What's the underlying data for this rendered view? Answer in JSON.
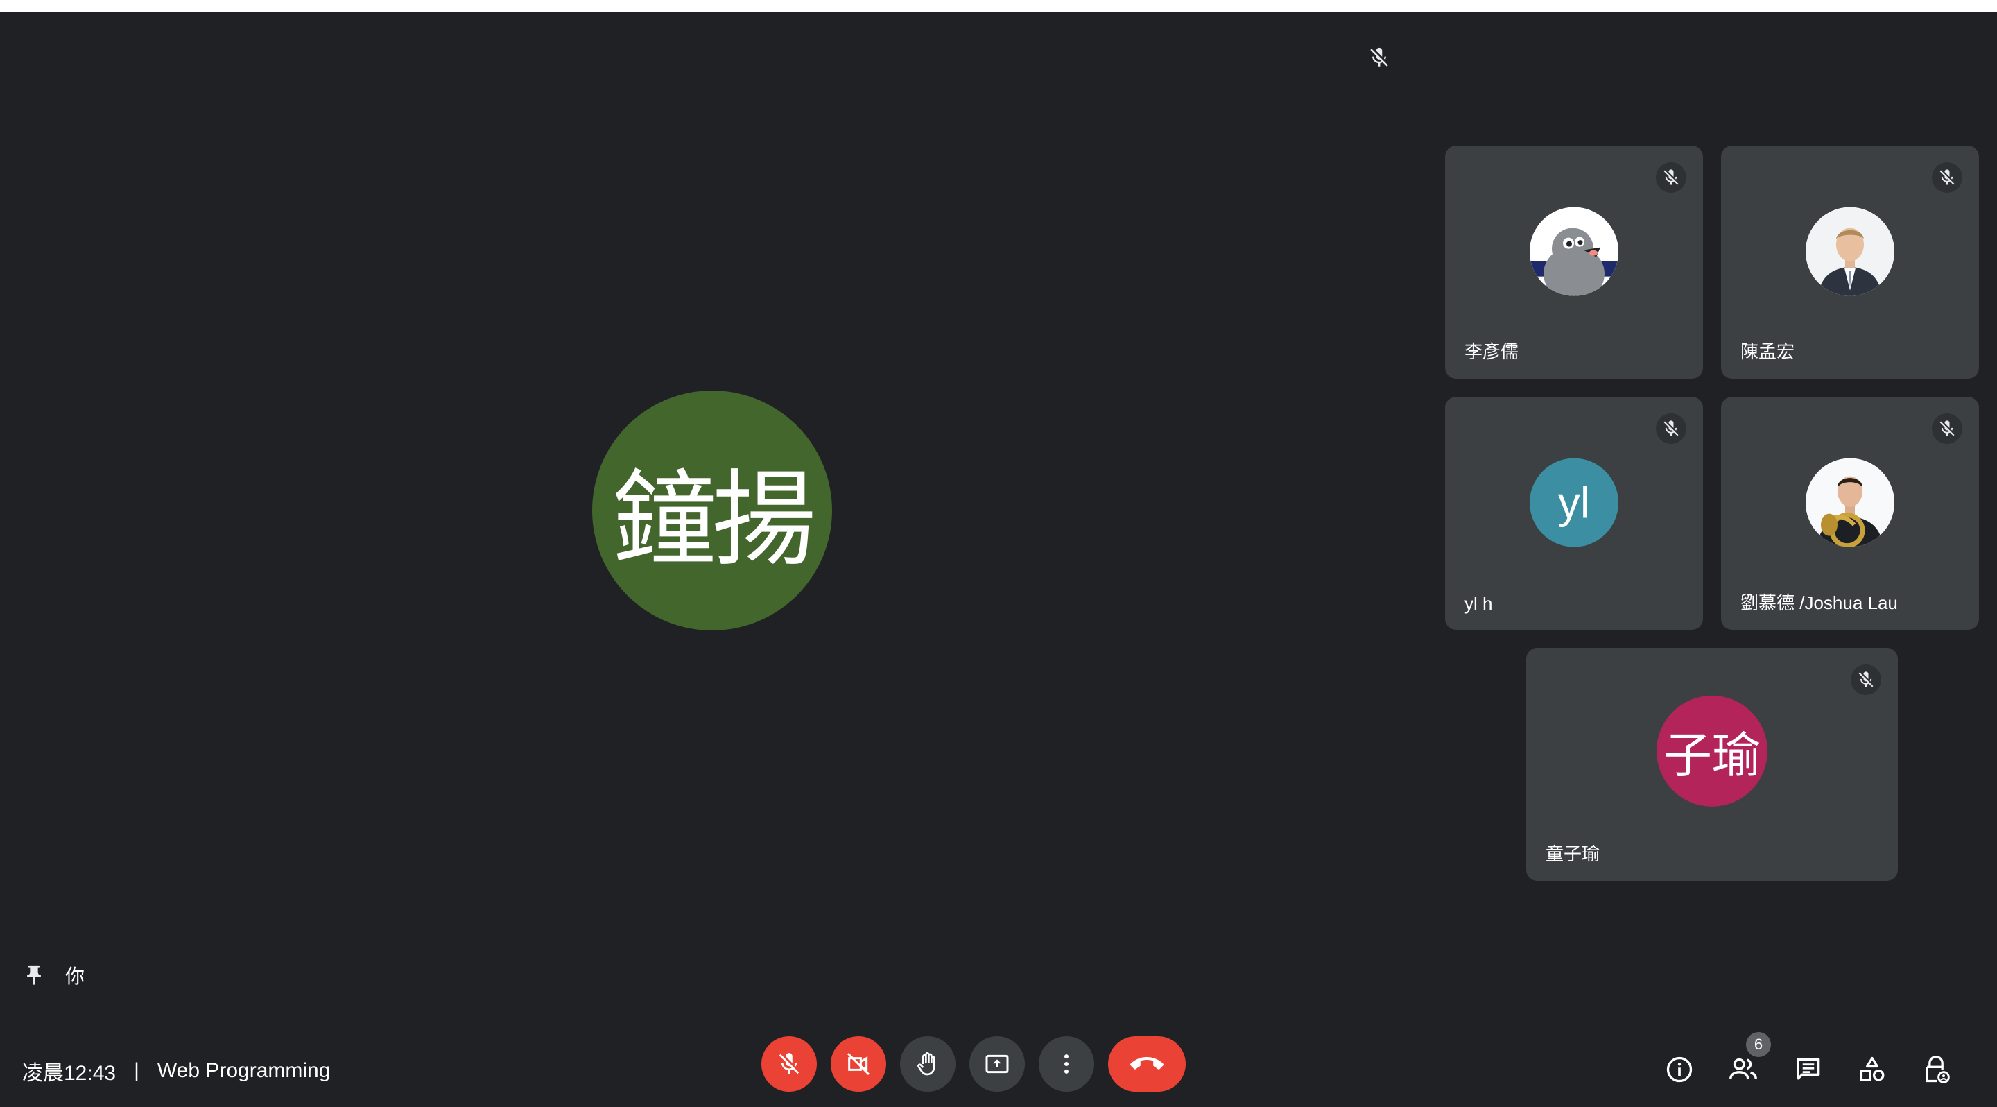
{
  "self": {
    "initials": "鐘揚",
    "avatar_color": "#43662c",
    "label": "你"
  },
  "participants": [
    {
      "name": "李彥儒",
      "avatar_type": "photo",
      "photo_icon": "pigeon-cartoon-avatar",
      "muted": true
    },
    {
      "name": "陳孟宏",
      "avatar_type": "photo",
      "photo_icon": "person-in-suit-avatar",
      "muted": true
    },
    {
      "name": "yl h",
      "avatar_type": "letter",
      "initials": "yl",
      "avatar_color": "#3c8fa3",
      "muted": true
    },
    {
      "name": "劉慕德 /Joshua Lau",
      "avatar_type": "photo",
      "photo_icon": "person-with-horn-avatar",
      "muted": true
    },
    {
      "name": "童子瑜",
      "avatar_type": "letter",
      "initials": "子瑜",
      "avatar_color": "#b3245a",
      "muted": true
    }
  ],
  "meeting": {
    "time": "凌晨12:43",
    "separator": "|",
    "title": "Web Programming"
  },
  "controls": {
    "mic": {
      "icon": "mic-off-icon",
      "state": "off"
    },
    "camera": {
      "icon": "camera-off-icon",
      "state": "off"
    },
    "raise_hand": {
      "icon": "hand-icon"
    },
    "present": {
      "icon": "present-screen-icon"
    },
    "more": {
      "icon": "more-vertical-icon"
    },
    "leave": {
      "icon": "phone-end-icon"
    }
  },
  "side_controls": {
    "people_count": "6",
    "items": [
      "info-icon",
      "people-icon",
      "chat-icon",
      "activities-icon",
      "host-controls-icon"
    ]
  },
  "colors": {
    "background": "#202124",
    "tile": "#3c4043",
    "danger": "#ea4335"
  }
}
